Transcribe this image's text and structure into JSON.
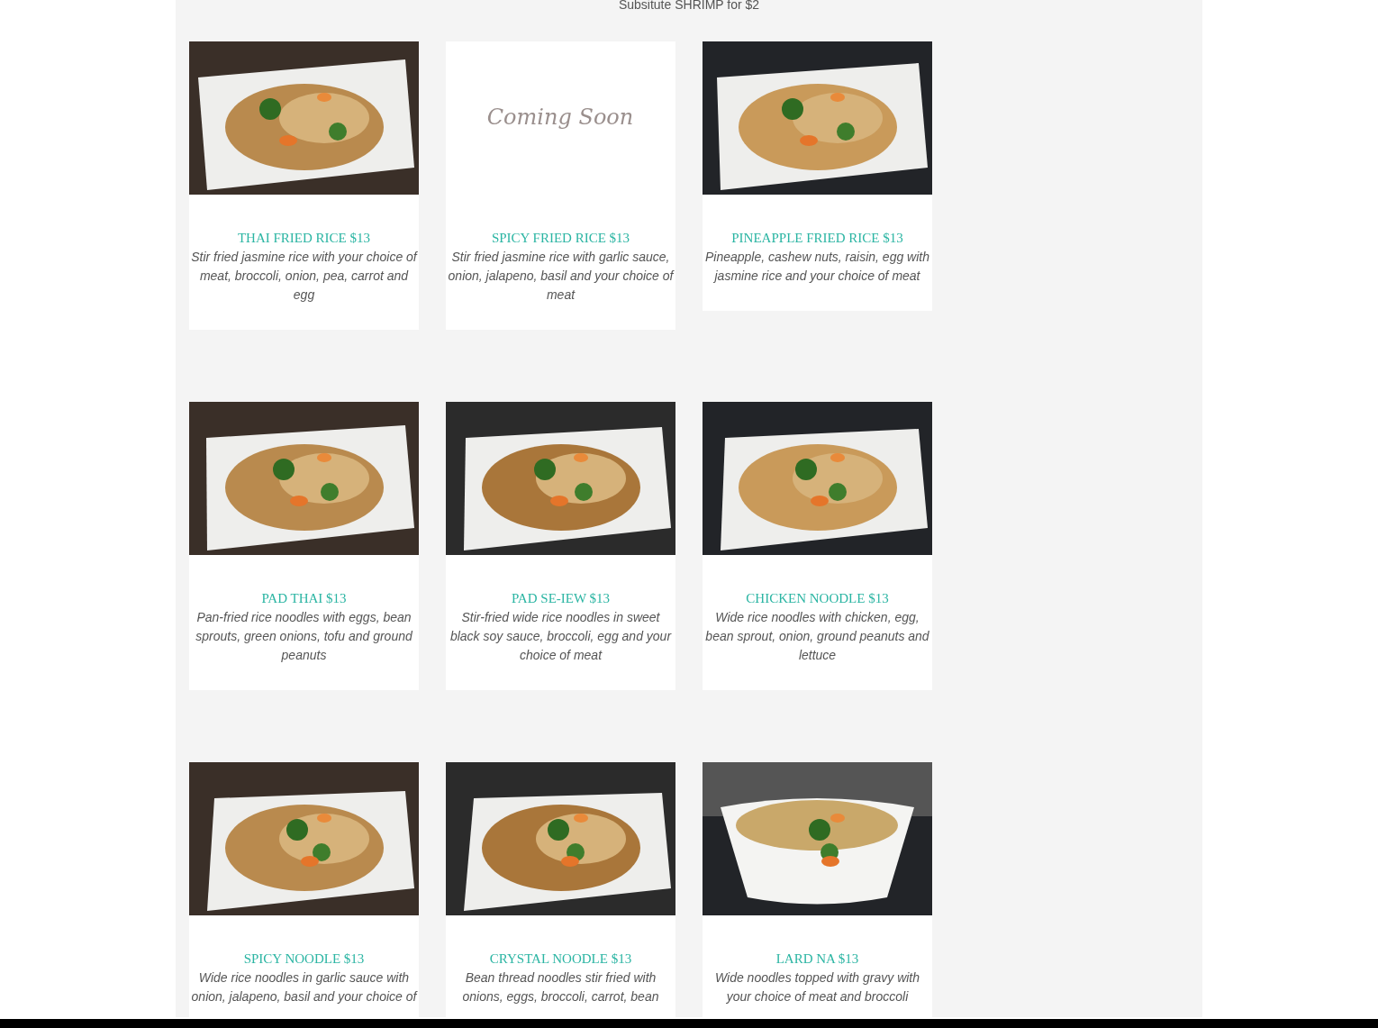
{
  "note": "Subsitute SHRIMP for $2",
  "dishes": [
    {
      "title": "THAI FRIED RICE $13",
      "description": "Stir fried jasmine rice with your choice of meat, broccoli, onion, pea, carrot and egg"
    },
    {
      "title": "SPICY FRIED RICE $13",
      "description": "Stir fried jasmine rice with garlic sauce, onion, jalapeno, basil and your choice of meat",
      "image": {
        "kind": "placeholder"
      }
    },
    {
      "title": "PINEAPPLE FRIED RICE $13",
      "description": "Pineapple, cashew nuts, raisin, egg with jasmine rice and your choice of meat"
    },
    {
      "title": "PAD THAI $13",
      "description": "Pan-fried rice noodles with eggs, bean sprouts, green onions, tofu and ground peanuts"
    },
    {
      "title": "PAD SE-IEW $13",
      "description": "Stir-fried wide rice noodles in sweet black soy sauce, broccoli, egg and your choice of meat"
    },
    {
      "title": "CHICKEN NOODLE $13",
      "description": "Wide rice noodles with chicken, egg, bean sprout, onion, ground peanuts and lettuce"
    },
    {
      "title": "SPICY NOODLE $13",
      "description": "Wide rice noodles in garlic sauce with onion, jalapeno, basil and your choice of"
    },
    {
      "title": "CRYSTAL NOODLE $13",
      "description": "Bean thread noodles stir fried with onions, eggs, broccoli, carrot, bean"
    },
    {
      "title": "LARD NA $13",
      "description": "Wide noodles topped with gravy with your choice of meat and broccoli"
    }
  ],
  "placeholder_image_text": "Coming Soon"
}
